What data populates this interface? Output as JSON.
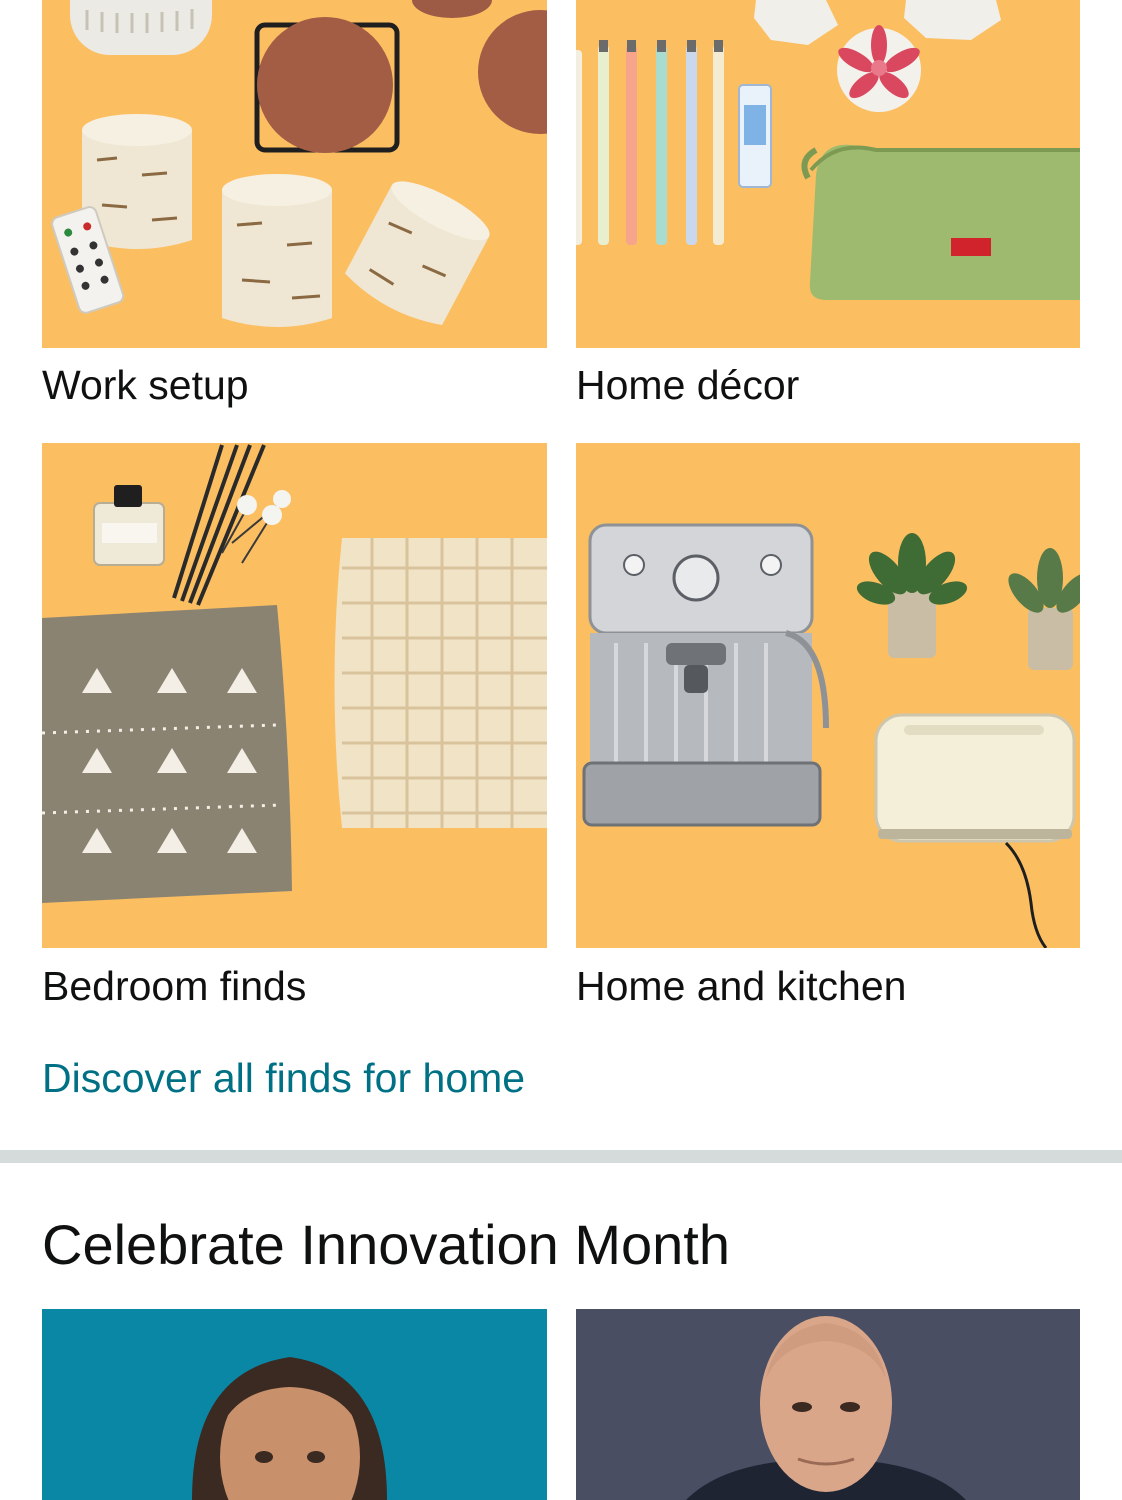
{
  "home_finds": {
    "tiles": [
      {
        "label": "Work setup",
        "image_icon": "candles-coasters-image",
        "bg_color": "#fbbf62"
      },
      {
        "label": "Home décor",
        "image_icon": "pens-pouch-image",
        "bg_color": "#fbbf62"
      },
      {
        "label": "Bedroom finds",
        "image_icon": "pillow-blanket-image",
        "bg_color": "#fbbf62"
      },
      {
        "label": "Home and kitchen",
        "image_icon": "espresso-toaster-image",
        "bg_color": "#fbbf62"
      }
    ],
    "discover_link": "Discover all finds for home",
    "link_color": "#007185"
  },
  "innovation": {
    "title": "Celebrate Innovation Month",
    "cards": [
      {
        "image_icon": "woman-portrait-image",
        "bg_color": "#0b87a6"
      },
      {
        "image_icon": "man-portrait-image",
        "bg_color": "#4a4e63"
      }
    ]
  }
}
